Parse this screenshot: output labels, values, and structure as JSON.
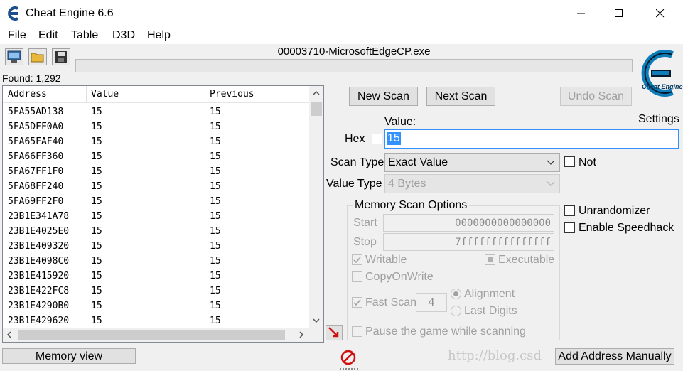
{
  "window": {
    "title": "Cheat Engine 6.6",
    "controls": [
      "minimize-icon",
      "maximize-icon",
      "close-icon"
    ]
  },
  "menu": [
    "File",
    "Edit",
    "Table",
    "D3D",
    "Help"
  ],
  "toolbar": {
    "icons": [
      "select-process-icon",
      "open-folder-icon",
      "save-disk-icon"
    ],
    "process_name": "00003710-MicrosoftEdgeCP.exe",
    "progress": 0
  },
  "found": "Found: 1,292",
  "list": {
    "columns": [
      "Address",
      "Value",
      "Previous"
    ],
    "rows": [
      {
        "address": "5FA55AD138",
        "value": "15",
        "previous": "15"
      },
      {
        "address": "5FA5DFF0A0",
        "value": "15",
        "previous": "15"
      },
      {
        "address": "5FA65FAF40",
        "value": "15",
        "previous": "15"
      },
      {
        "address": "5FA66FF360",
        "value": "15",
        "previous": "15"
      },
      {
        "address": "5FA67FF1F0",
        "value": "15",
        "previous": "15"
      },
      {
        "address": "5FA68FF240",
        "value": "15",
        "previous": "15"
      },
      {
        "address": "5FA69FF2F0",
        "value": "15",
        "previous": "15"
      },
      {
        "address": "23B1E341A78",
        "value": "15",
        "previous": "15"
      },
      {
        "address": "23B1E4025E0",
        "value": "15",
        "previous": "15"
      },
      {
        "address": "23B1E409320",
        "value": "15",
        "previous": "15"
      },
      {
        "address": "23B1E4098C0",
        "value": "15",
        "previous": "15"
      },
      {
        "address": "23B1E415920",
        "value": "15",
        "previous": "15"
      },
      {
        "address": "23B1E422FC8",
        "value": "15",
        "previous": "15"
      },
      {
        "address": "23B1E4290B0",
        "value": "15",
        "previous": "15"
      },
      {
        "address": "23B1E429620",
        "value": "15",
        "previous": "15"
      }
    ]
  },
  "buttons": {
    "new_scan": "New Scan",
    "next_scan": "Next Scan",
    "undo_scan": "Undo Scan",
    "memory_view": "Memory view",
    "add_address": "Add Address Manually"
  },
  "logo": {
    "text": "Cheat Engine",
    "settings": "Settings"
  },
  "scan": {
    "value_label": "Value:",
    "hex_label": "Hex",
    "value": "15",
    "scan_type_label": "Scan Type",
    "scan_type": "Exact Value",
    "not_label": "Not",
    "value_type_label": "Value Type",
    "value_type": "4 Bytes"
  },
  "memory_options": {
    "title": "Memory Scan Options",
    "start_label": "Start",
    "start": "0000000000000000",
    "stop_label": "Stop",
    "stop": "7fffffffffffffff",
    "writable": "Writable",
    "executable": "Executable",
    "copy_on_write": "CopyOnWrite",
    "fast_scan": "Fast Scan",
    "fast_scan_value": "4",
    "alignment": "Alignment",
    "last_digits": "Last Digits",
    "pause": "Pause the game while scanning"
  },
  "options": {
    "unrandomizer": "Unrandomizer",
    "speedhack": "Enable Speedhack"
  },
  "watermark": "http://blog.csd",
  "colors": {
    "accent": "#3390ff",
    "logo_blue": "#0e7cb8"
  }
}
